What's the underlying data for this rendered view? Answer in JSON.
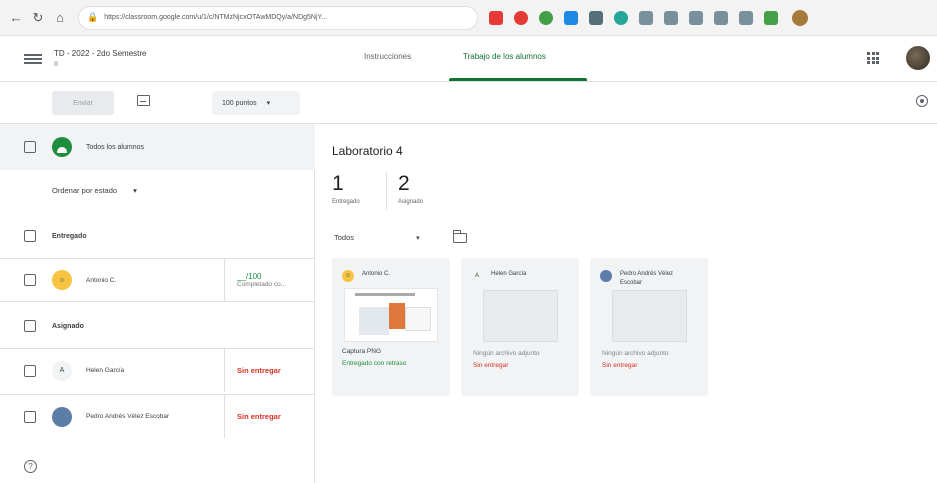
{
  "browser": {
    "url": "https://classroom.google.com/u/1/c/NTMzNjcxOTAwMDQy/a/NDg5NjY... ",
    "extension_colors": [
      "#e53935",
      "#e53935",
      "#43a047",
      "#1e88e5",
      "#546e7a",
      "#26a69a",
      "#546e7a",
      "#546e7a",
      "#546e7a",
      "#546e7a",
      "#546e7a",
      "#546e7a"
    ]
  },
  "header": {
    "course_title": "TD - 2022 - 2do Semestre",
    "course_section": "II",
    "tabs": [
      {
        "label": "Instrucciones",
        "active": false
      },
      {
        "label": "Trabajo de los alumnos",
        "active": true
      }
    ]
  },
  "toolbar": {
    "send_label": "Enviar",
    "points_label": "100 puntos",
    "points_caret": "▾"
  },
  "left": {
    "all_students_label": "Todos los alumnos",
    "sort_label": "Ordenar por estado",
    "sort_caret": "▾",
    "sections": [
      {
        "title": "Entregado",
        "students": [
          {
            "name": "Antonio C.",
            "status": "__/100",
            "status_sub": "Completado co..."
          }
        ]
      },
      {
        "title": "Asignado",
        "students": [
          {
            "name": "Helen García",
            "status": "Sin entregar"
          },
          {
            "name": "Pedro Andrés Vélez Escobar",
            "status": "Sin entregar"
          }
        ]
      }
    ]
  },
  "main": {
    "assignment_title": "Laboratorio 4",
    "stats": [
      {
        "value": "1",
        "label": "Entregado"
      },
      {
        "value": "2",
        "label": "Asignado"
      }
    ],
    "filter_label": "Todos",
    "filter_caret": "▾",
    "cards": [
      {
        "name": "Antonio C.",
        "file": "Captura PNG",
        "status": "Entregado con retraso"
      },
      {
        "name": "Helen García",
        "file": "Ningún archivo adjunto",
        "status": "Sin entregar"
      },
      {
        "name": "Pedro Andrés Vélez Escobar",
        "file": "Ningún archivo adjunto",
        "status": "Sin entregar"
      }
    ]
  },
  "colors": {
    "accent": "#137333",
    "missing": "#d93025",
    "late": "#1e8e3e"
  }
}
